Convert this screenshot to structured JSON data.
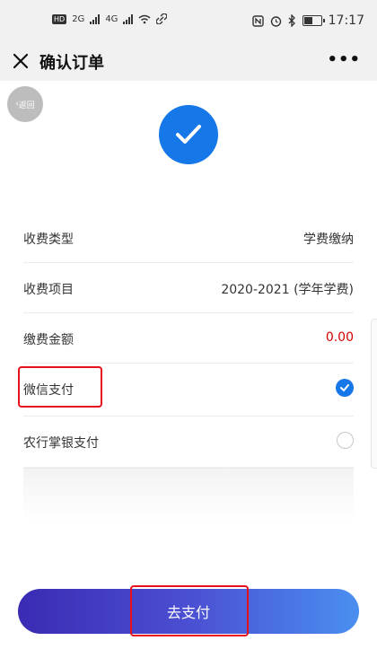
{
  "status_bar": {
    "net1": "2G",
    "net2": "4G",
    "time": "17:17"
  },
  "nav": {
    "title": "确认订单",
    "more": "•••"
  },
  "back_label": "返回",
  "rows": [
    {
      "label": "收费类型",
      "value": "学费缴纳"
    },
    {
      "label": "收费项目",
      "value": "2020-2021 (学年学费)"
    },
    {
      "label": "缴费金额",
      "value": "0.00"
    }
  ],
  "payment_options": [
    {
      "label": "微信支付",
      "selected": true
    },
    {
      "label": "农行掌银支付",
      "selected": false
    }
  ],
  "pay_button_label": "去支付",
  "colors": {
    "accent": "#1677e8",
    "amount": "#d60000",
    "highlight": "#e8101b",
    "button_start": "#3a2bb3",
    "button_end": "#4a8ff0"
  }
}
